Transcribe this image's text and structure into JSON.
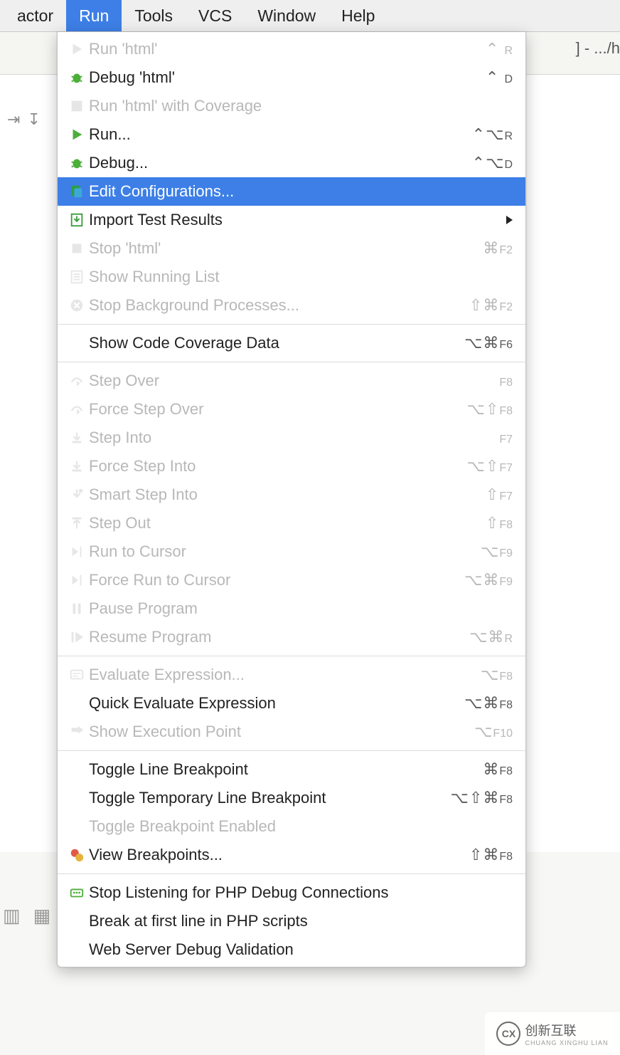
{
  "menubar": {
    "items": [
      {
        "label": "actor"
      },
      {
        "label": "Run"
      },
      {
        "label": "Tools"
      },
      {
        "label": "VCS"
      },
      {
        "label": "Window"
      },
      {
        "label": "Help"
      }
    ],
    "activeIndex": 1
  },
  "bg": {
    "titleFragment": "] - .../h"
  },
  "menu": {
    "groups": [
      [
        {
          "icon": "play",
          "label": "Run 'html'",
          "shortcut": "⌃ R",
          "disabled": true
        },
        {
          "icon": "bug",
          "label": "Debug 'html'",
          "shortcut": "⌃ D",
          "disabled": false
        },
        {
          "icon": "coverage",
          "label": "Run 'html' with Coverage",
          "shortcut": "",
          "disabled": true
        },
        {
          "icon": "play",
          "label": "Run...",
          "shortcut": "⌃⌥R",
          "disabled": false
        },
        {
          "icon": "bug",
          "label": "Debug...",
          "shortcut": "⌃⌥D",
          "disabled": false
        },
        {
          "icon": "edit-config",
          "label": "Edit Configurations...",
          "shortcut": "",
          "selected": true
        },
        {
          "icon": "import",
          "label": "Import Test Results",
          "shortcut": "",
          "submenu": true
        },
        {
          "icon": "stop",
          "label": "Stop 'html'",
          "shortcut": "⌘F2",
          "disabled": true
        },
        {
          "icon": "list",
          "label": "Show Running List",
          "shortcut": "",
          "disabled": true
        },
        {
          "icon": "stop-circle",
          "label": "Stop Background Processes...",
          "shortcut": "⇧⌘F2",
          "disabled": true
        }
      ],
      [
        {
          "icon": "",
          "label": "Show Code Coverage Data",
          "shortcut": "⌥⌘F6"
        }
      ],
      [
        {
          "icon": "step-over",
          "label": "Step Over",
          "shortcut": "F8",
          "disabled": true
        },
        {
          "icon": "force-step-over",
          "label": "Force Step Over",
          "shortcut": "⌥⇧F8",
          "disabled": true
        },
        {
          "icon": "step-into",
          "label": "Step Into",
          "shortcut": "F7",
          "disabled": true
        },
        {
          "icon": "force-step-into",
          "label": "Force Step Into",
          "shortcut": "⌥⇧F7",
          "disabled": true
        },
        {
          "icon": "smart-step-into",
          "label": "Smart Step Into",
          "shortcut": "⇧F7",
          "disabled": true
        },
        {
          "icon": "step-out",
          "label": "Step Out",
          "shortcut": "⇧F8",
          "disabled": true
        },
        {
          "icon": "run-to-cursor",
          "label": "Run to Cursor",
          "shortcut": "⌥F9",
          "disabled": true
        },
        {
          "icon": "force-run-to-cursor",
          "label": "Force Run to Cursor",
          "shortcut": "⌥⌘F9",
          "disabled": true
        },
        {
          "icon": "pause",
          "label": "Pause Program",
          "shortcut": "",
          "disabled": true
        },
        {
          "icon": "resume",
          "label": "Resume Program",
          "shortcut": "⌥⌘R",
          "disabled": true
        }
      ],
      [
        {
          "icon": "evaluate",
          "label": "Evaluate Expression...",
          "shortcut": "⌥F8",
          "disabled": true
        },
        {
          "icon": "",
          "label": "Quick Evaluate Expression",
          "shortcut": "⌥⌘F8"
        },
        {
          "icon": "exec-point",
          "label": "Show Execution Point",
          "shortcut": "⌥F10",
          "disabled": true
        }
      ],
      [
        {
          "icon": "",
          "label": "Toggle Line Breakpoint",
          "shortcut": "⌘F8"
        },
        {
          "icon": "",
          "label": "Toggle Temporary Line Breakpoint",
          "shortcut": "⌥⇧⌘F8"
        },
        {
          "icon": "",
          "label": "Toggle Breakpoint Enabled",
          "shortcut": "",
          "disabled": true
        },
        {
          "icon": "breakpoints",
          "label": "View Breakpoints...",
          "shortcut": "⇧⌘F8"
        }
      ],
      [
        {
          "icon": "php-listen",
          "label": "Stop Listening for PHP Debug Connections",
          "shortcut": ""
        },
        {
          "icon": "",
          "label": "Break at first line in PHP scripts",
          "shortcut": ""
        },
        {
          "icon": "",
          "label": "Web Server Debug Validation",
          "shortcut": ""
        }
      ]
    ]
  },
  "watermark": {
    "brand": "创新互联",
    "sub": "CHUANG XINGHU LIAN",
    "mark": "CX"
  }
}
